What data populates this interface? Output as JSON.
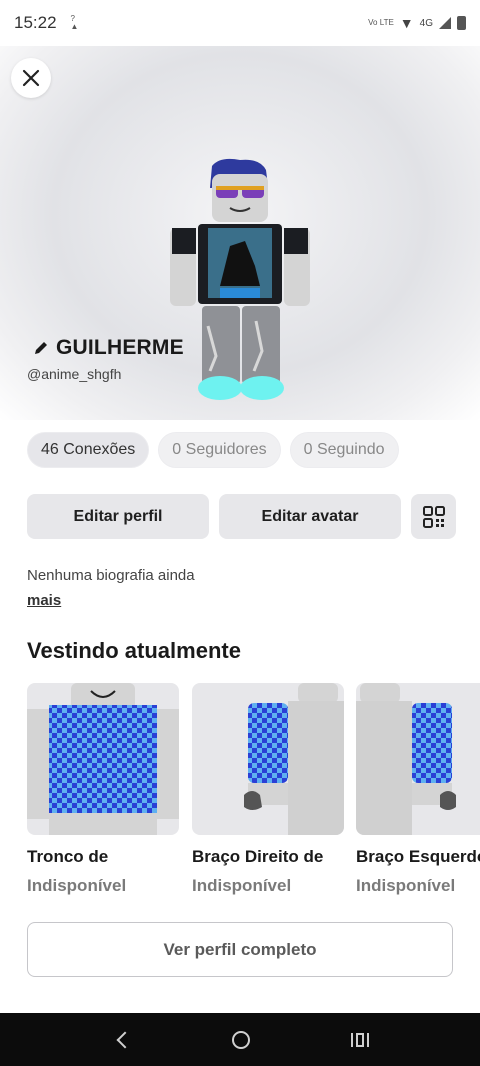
{
  "status_bar": {
    "time": "15:22",
    "network": "4G",
    "volte": "Vo LTE"
  },
  "header": {
    "close_icon": "close-icon"
  },
  "profile": {
    "display_name": "GUILHERME",
    "username": "@anime_shgfh",
    "edit_icon": "pencil-icon"
  },
  "stats": {
    "connections": "46 Conexões",
    "followers": "0 Seguidores",
    "following": "0 Seguindo"
  },
  "actions": {
    "edit_profile": "Editar perfil",
    "edit_avatar": "Editar avatar",
    "qr_icon": "qr-code-icon"
  },
  "bio": {
    "text": "Nenhuma biografia ainda",
    "more": "mais"
  },
  "wearing": {
    "title": "Vestindo atualmente",
    "items": [
      {
        "name": "Tronco de",
        "status": "Indisponível"
      },
      {
        "name": "Braço Direito de",
        "status": "Indisponível"
      },
      {
        "name": "Braço Esquerdo",
        "status": "Indisponível"
      }
    ]
  },
  "footer": {
    "full_profile": "Ver perfil completo"
  },
  "colors": {
    "chip_bg": "#f0f0f2",
    "button_bg": "#e7e7ea",
    "nav_bg": "#0c0c0c",
    "shirt_blue": "#2a3fd6",
    "shirt_cyan": "#5fb0f0"
  }
}
